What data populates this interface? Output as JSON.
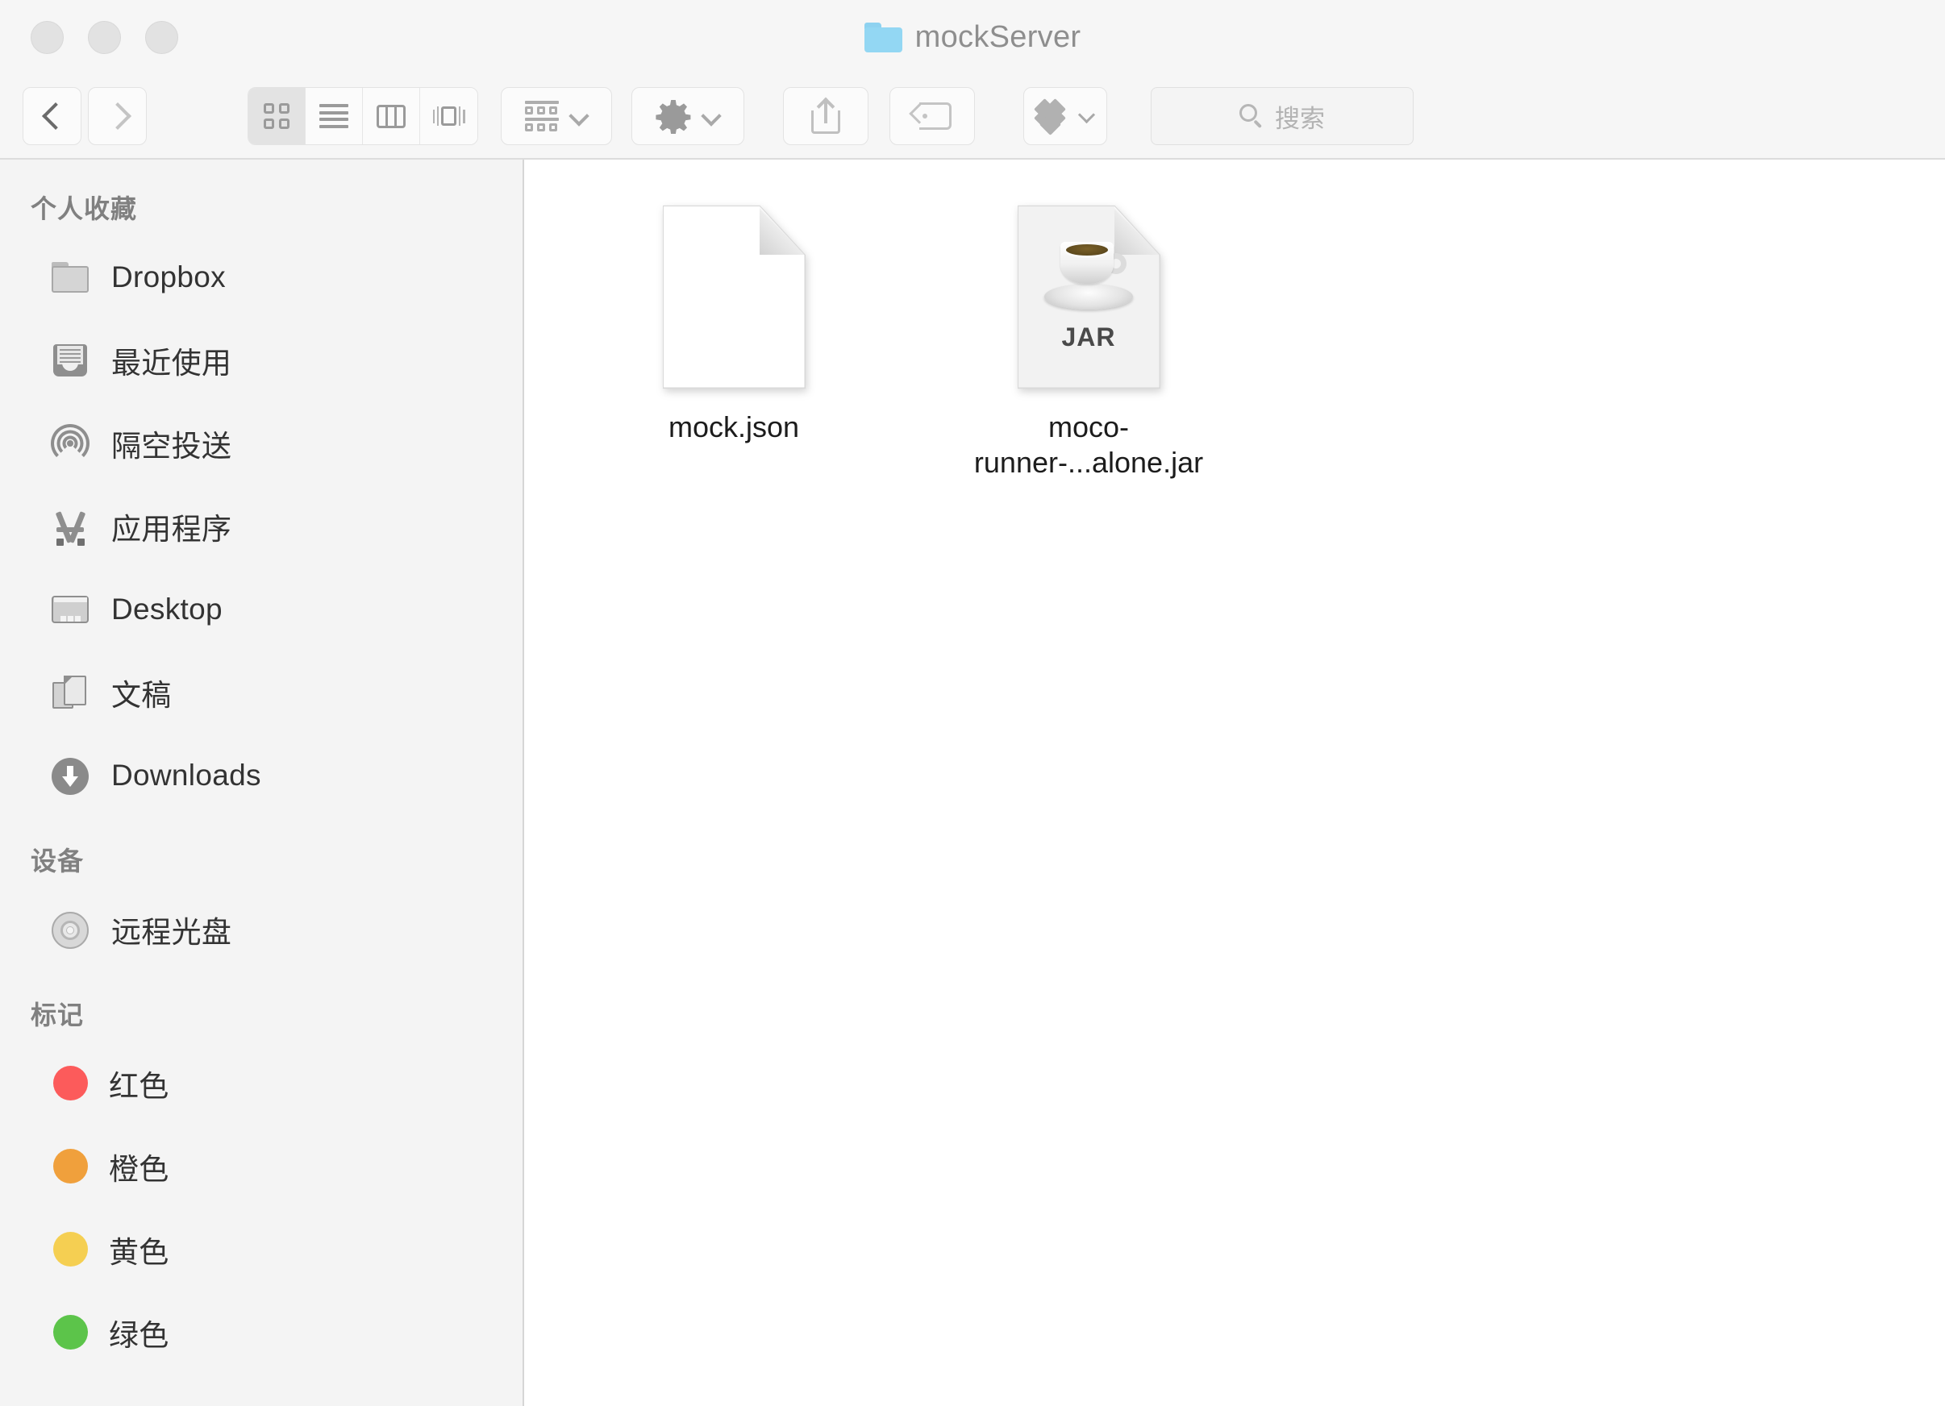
{
  "window": {
    "title": "mockServer",
    "title_icon": "folder-icon",
    "traffic_lights": [
      "close-button",
      "minimize-button",
      "zoom-button"
    ]
  },
  "toolbar": {
    "back_icon": "chevron-left-icon",
    "forward_icon": "chevron-right-icon",
    "view_modes": [
      {
        "name": "icon-view",
        "icon": "grid-icon",
        "active": true
      },
      {
        "name": "list-view",
        "icon": "list-icon",
        "active": false
      },
      {
        "name": "column-view",
        "icon": "columns-icon",
        "active": false
      },
      {
        "name": "gallery-view",
        "icon": "gallery-icon",
        "active": false
      }
    ],
    "arrange_icon": "arrange-icon",
    "action_icon": "gear-icon",
    "share_icon": "share-icon",
    "tag_icon": "tag-icon",
    "dropbox_icon": "dropbox-icon",
    "chevron_icon": "chevron-down-icon"
  },
  "search": {
    "placeholder": "搜索",
    "value": "",
    "icon": "search-icon"
  },
  "sidebar": {
    "sections": [
      {
        "header": "个人收藏",
        "items": [
          {
            "label": "Dropbox",
            "icon": "folder-icon"
          },
          {
            "label": "最近使用",
            "icon": "recents-icon"
          },
          {
            "label": "隔空投送",
            "icon": "airdrop-icon"
          },
          {
            "label": "应用程序",
            "icon": "applications-icon"
          },
          {
            "label": "Desktop",
            "icon": "desktop-icon"
          },
          {
            "label": "文稿",
            "icon": "documents-icon"
          },
          {
            "label": "Downloads",
            "icon": "downloads-icon"
          }
        ]
      },
      {
        "header": "设备",
        "items": [
          {
            "label": "远程光盘",
            "icon": "remote-disc-icon"
          }
        ]
      },
      {
        "header": "标记",
        "items": [
          {
            "label": "红色",
            "icon": "tag-dot",
            "color": "#fc5b5b"
          },
          {
            "label": "橙色",
            "icon": "tag-dot",
            "color": "#f0a03c"
          },
          {
            "label": "黄色",
            "icon": "tag-dot",
            "color": "#f5cf52"
          },
          {
            "label": "绿色",
            "icon": "tag-dot",
            "color": "#5cc martin"
          }
        ]
      }
    ]
  },
  "content": {
    "files": [
      {
        "name": "mock.json",
        "icon": "blank-document-icon",
        "badge": ""
      },
      {
        "name": "moco-runner-...alone.jar",
        "icon": "jar-coffee-icon",
        "badge": "JAR"
      }
    ]
  }
}
